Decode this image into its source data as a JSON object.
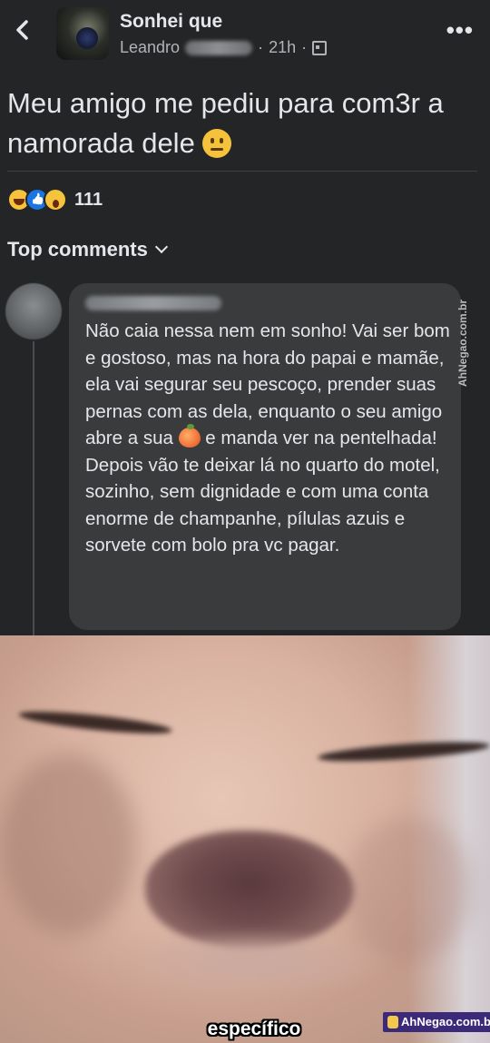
{
  "header": {
    "back_icon": "chevron-left-icon",
    "group_name": "Sonhei que",
    "author_visible": "Leandro",
    "time": "21h",
    "separator": "·",
    "audience_icon": "group-visibility-icon",
    "more_icon": "more-horizontal-icon",
    "more_label": "•••"
  },
  "post": {
    "text": "Meu amigo me pediu para com3r a namorada dele",
    "emoji": "neutral-face-emoji"
  },
  "reactions": {
    "types": [
      "haha",
      "like",
      "wow"
    ],
    "count": "111"
  },
  "comments": {
    "sort_label": "Top comments",
    "items": [
      {
        "text_lines": [
          "Não caia nessa nem em sonho! Vai ser bom e gostoso, mas na hora do papai e mamãe, ela vai segurar seu pescoço, prender suas pernas com as dela,",
          "enquanto o seu amigo abre a sua",
          "e manda ver na pentelhada!",
          "Depois vão te deixar lá no quarto do motel, sozinho, sem dignidade e com uma conta enorme de champanhe, pílulas azuis e sorvete com bolo pra vc pagar."
        ],
        "emoji": "peach-emoji"
      }
    ]
  },
  "watermark": {
    "vertical": "AhNegao.com.br",
    "badge": "AhNegao.com.br"
  },
  "meme": {
    "caption": "específico"
  },
  "colors": {
    "background": "#242526",
    "bubble": "#3a3b3c",
    "text": "#e4e6eb",
    "secondary_text": "#b0b3b8",
    "like_blue": "#1b74e4"
  }
}
